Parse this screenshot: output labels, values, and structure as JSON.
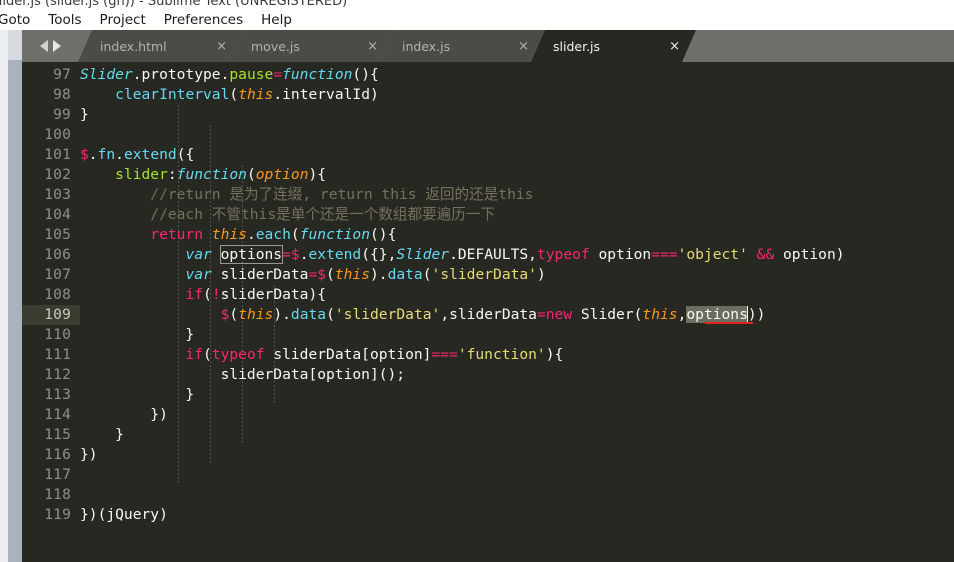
{
  "window": {
    "title": "slider.js (slider.js (gh)) - Sublime Text (UNREGISTERED)"
  },
  "menu": {
    "items": [
      {
        "label": "Goto"
      },
      {
        "label": "Tools"
      },
      {
        "label": "Project"
      },
      {
        "label": "Preferences"
      },
      {
        "label": "Help"
      }
    ]
  },
  "tab_bar": {
    "nav_prev_icon": "arrow-left-icon",
    "nav_next_icon": "arrow-right-icon",
    "close_glyph": "×",
    "tabs": [
      {
        "label": "index.html",
        "active": false
      },
      {
        "label": "move.js",
        "active": false
      },
      {
        "label": "index.js",
        "active": false
      },
      {
        "label": "slider.js",
        "active": true
      }
    ]
  },
  "editor": {
    "active_file": "slider.js",
    "current_line": 109,
    "first_line": 97,
    "last_line": 119,
    "selected_text": "options",
    "match_highlight_text": "options",
    "colors": {
      "background": "#272822",
      "gutter_text": "#8f9089",
      "current_line_gutter": "#3b3c30",
      "keyword": "#f92672",
      "class": "#66d9ef",
      "function": "#a6e22e",
      "string": "#e6db74",
      "this": "#fd971f",
      "comment": "#75715e",
      "plain": "#f8f8f2",
      "error_underline": "#e52222",
      "selection": "#6c6c60",
      "tab_bar": "#6f6f6b",
      "tab_inactive": "#4c4c47",
      "scrollbar_thumb": "#a9b2bd"
    },
    "lines": [
      {
        "n": "97",
        "text": "Slider.prototype.pause=function(){"
      },
      {
        "n": "98",
        "text": "    clearInterval(this.intervalId)"
      },
      {
        "n": "99",
        "text": "}"
      },
      {
        "n": "100",
        "text": ""
      },
      {
        "n": "101",
        "text": "$.fn.extend({"
      },
      {
        "n": "102",
        "text": "    slider:function(option){"
      },
      {
        "n": "103",
        "text": "        //return 是为了连缀, return this 返回的还是this"
      },
      {
        "n": "104",
        "text": "        //each 不管this是单个还是一个数组都要遍历一下"
      },
      {
        "n": "105",
        "text": "        return this.each(function(){"
      },
      {
        "n": "106",
        "text": "            var options=$.extend({},Slider.DEFAULTS,typeof option==='object' && option)"
      },
      {
        "n": "107",
        "text": "            var sliderData=$(this).data('sliderData')"
      },
      {
        "n": "108",
        "text": "            if(!sliderData){"
      },
      {
        "n": "109",
        "text": "                $(this).data('sliderData',sliderData=new Slider(this,options))"
      },
      {
        "n": "110",
        "text": "            }"
      },
      {
        "n": "111",
        "text": "            if(typeof sliderData[option]==='function'){"
      },
      {
        "n": "112",
        "text": "                sliderData[option]();"
      },
      {
        "n": "113",
        "text": "            }"
      },
      {
        "n": "114",
        "text": "        })"
      },
      {
        "n": "115",
        "text": "    }"
      },
      {
        "n": "116",
        "text": "})"
      },
      {
        "n": "117",
        "text": ""
      },
      {
        "n": "118",
        "text": ""
      },
      {
        "n": "119",
        "text": "})(jQuery)"
      }
    ]
  }
}
